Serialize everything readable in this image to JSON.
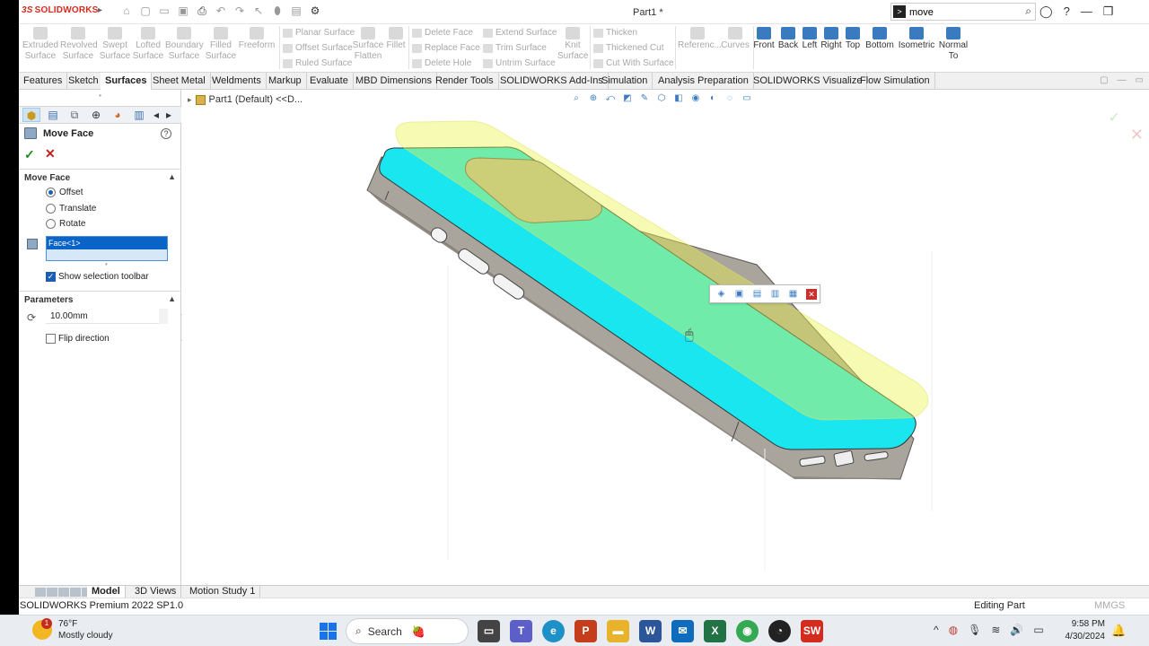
{
  "app": {
    "logo": "SOLIDWORKS",
    "logo_mark": "3S",
    "document_title": "Part1 *"
  },
  "search": {
    "value": "move",
    "placeholder": ""
  },
  "ribbon": {
    "surfaces_large": [
      "Extruded Surface",
      "Revolved Surface",
      "Swept Surface",
      "Lofted Surface",
      "Boundary Surface",
      "Filled Surface",
      "Freeform"
    ],
    "surfaces_small": [
      "Planar Surface",
      "Offset Surface",
      "Ruled Surface"
    ],
    "flatten": "Surface Flatten",
    "fillet": "Fillet",
    "face_tools": [
      "Delete Face",
      "Replace Face",
      "Delete Hole"
    ],
    "extend_tools": [
      "Extend Surface",
      "Trim Surface",
      "Untrim Surface"
    ],
    "knit": "Knit Surface",
    "thicken_tools": [
      "Thicken",
      "Thickened Cut",
      "Cut With Surface"
    ],
    "reference": "Referenc...",
    "curves": "Curves",
    "views": [
      "Front",
      "Back",
      "Left",
      "Right",
      "Top",
      "Bottom",
      "Isometric",
      "Normal To"
    ]
  },
  "tabs": [
    "Features",
    "Sketch",
    "Surfaces",
    "Sheet Metal",
    "Weldments",
    "Markup",
    "Evaluate",
    "MBD Dimensions",
    "Render Tools",
    "SOLIDWORKS Add-Ins",
    "Simulation",
    "Analysis Preparation",
    "SOLIDWORKS Visualize",
    "Flow Simulation"
  ],
  "active_tab": "Surfaces",
  "property_manager": {
    "title": "Move Face",
    "section_move": "Move Face",
    "options": [
      "Offset",
      "Translate",
      "Rotate"
    ],
    "selected_option": "Offset",
    "face_item": "Face<1>",
    "show_toolbar_label": "Show selection toolbar",
    "show_toolbar_checked": true,
    "section_params": "Parameters",
    "distance": "10.00mm",
    "flip_label": "Flip direction",
    "flip_checked": false
  },
  "viewport": {
    "tree_label": "Part1  (Default) <<D..."
  },
  "bottom_tabs": [
    "Model",
    "3D Views",
    "Motion Study 1"
  ],
  "active_bottom_tab": "Model",
  "status": {
    "left": "SOLIDWORKS Premium 2022 SP1.0",
    "editing": "Editing Part",
    "units": "MMGS"
  },
  "taskbar": {
    "weather_temp": "76°F",
    "weather_desc": "Mostly cloudy",
    "weather_badge": "1",
    "search_label": "Search",
    "time": "9:58 PM",
    "date": "4/30/2024"
  },
  "colors": {
    "accent": "#1a5fb4",
    "brand": "#d52b1e",
    "model_body": "#a9a49c",
    "model_face": "#19e6ef",
    "preview_face": "#f2f28a"
  }
}
